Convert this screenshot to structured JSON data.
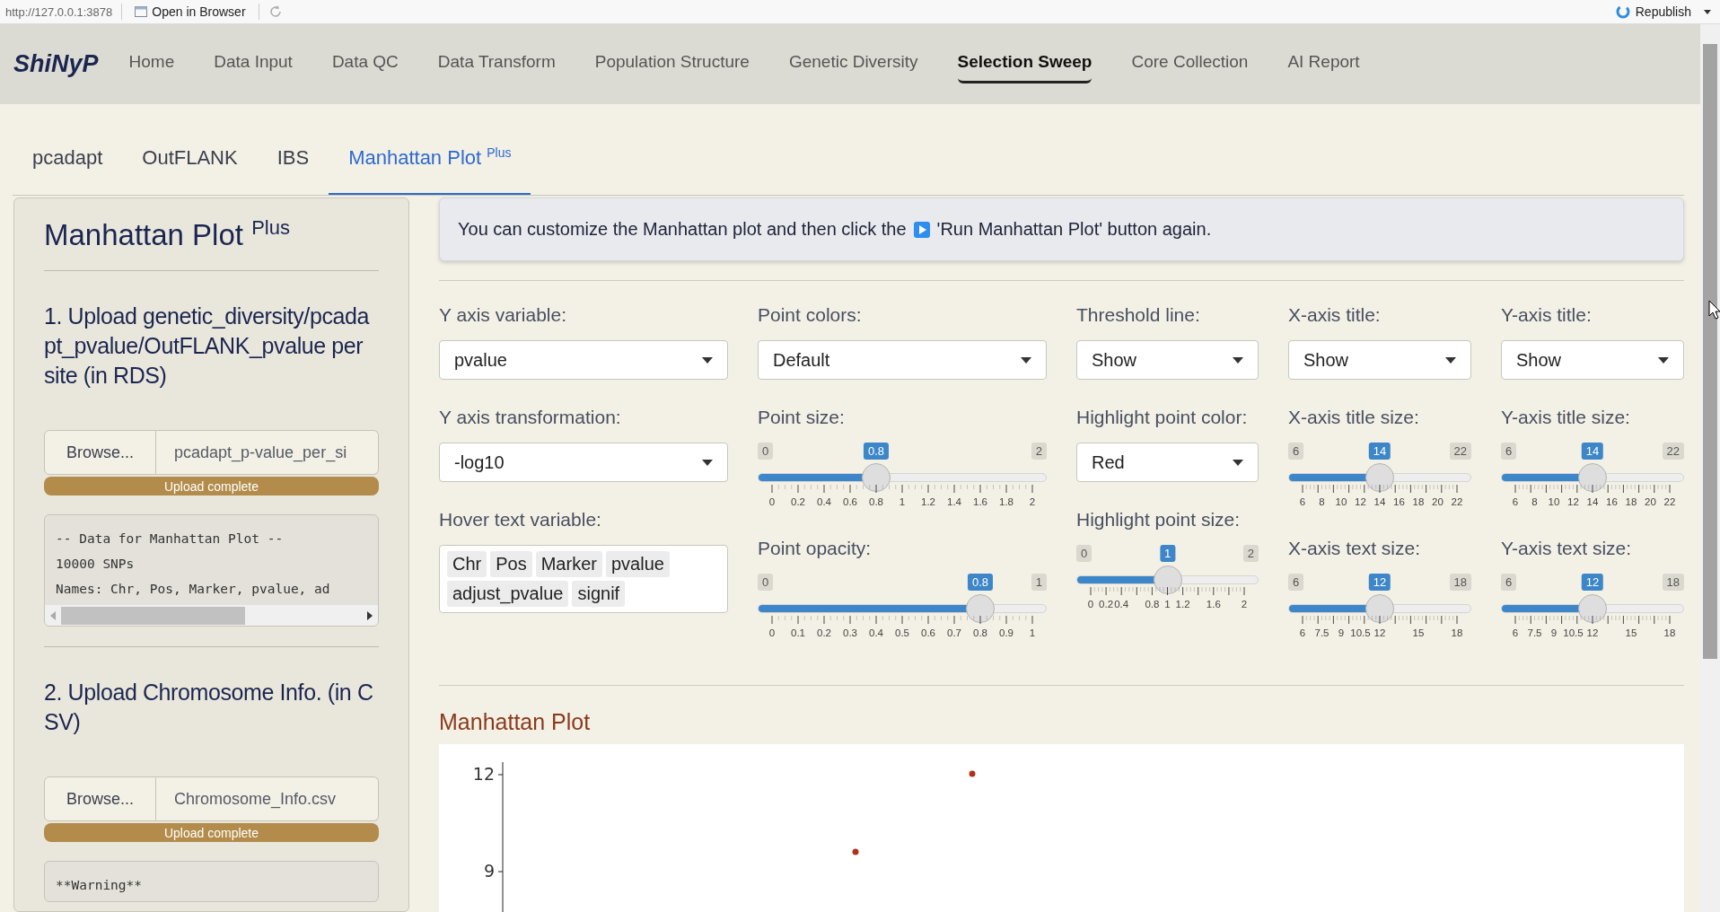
{
  "browser_bar": {
    "url": "http://127.0.0.1:3878",
    "open_button": "Open in Browser",
    "publish_button": "Republish"
  },
  "navbar": {
    "brand": "ShiNyP",
    "items": [
      {
        "label": "Home",
        "selected": false
      },
      {
        "label": "Data Input",
        "selected": false
      },
      {
        "label": "Data QC",
        "selected": false
      },
      {
        "label": "Data Transform",
        "selected": false
      },
      {
        "label": "Population Structure",
        "selected": false
      },
      {
        "label": "Genetic Diversity",
        "selected": false
      },
      {
        "label": "Selection Sweep",
        "selected": true
      },
      {
        "label": "Core Collection",
        "selected": false
      },
      {
        "label": "AI Report",
        "selected": false
      }
    ]
  },
  "tabs": [
    {
      "label": "pcadapt",
      "selected": false
    },
    {
      "label": "OutFLANK",
      "selected": false
    },
    {
      "label": "IBS",
      "selected": false
    },
    {
      "label": "Manhattan Plot $^{Plus}$",
      "selected": true
    }
  ],
  "sidebar": {
    "title": "Manhattan Plot $^{Plus}$",
    "steps": [
      {
        "heading": "1. Upload genetic_diversity/pcadapt_pvalue/OutFLANK_pvalue per site (in RDS)",
        "browse": "Browse...",
        "file": "pcadapt_p-value_per_si",
        "progress": {
          "label": "Upload complete",
          "level": 1
        },
        "output": [
          "-- Data for Manhattan Plot --",
          "10000 SNPs",
          "Names: Chr, Pos, Marker, pvalue, ad"
        ],
        "output_scrollbar": true
      },
      {
        "heading": "2. Upload Chromosome Info. (in CSV)",
        "browse": "Browse...",
        "file": "Chromosome_Info.csv",
        "progress": {
          "label": "Upload complete",
          "level": 1
        },
        "output": [
          "**Warning**"
        ],
        "output_scrollbar": false
      }
    ]
  },
  "info": {
    "text_before": "You can customize the Manhattan plot and then click the",
    "text_after": "'Run Manhattan Plot' button again."
  },
  "settings": {
    "columns": [
      {
        "controls": [
          {
            "kind": "select",
            "label": "Y axis variable:",
            "value": "pvalue"
          },
          {
            "kind": "select",
            "label": "Y axis transformation:",
            "value": "-log10"
          },
          {
            "kind": "multi",
            "label": "Hover text variable:",
            "tokens": [
              "Chr",
              "Pos",
              "Marker",
              "pvalue",
              "adjust_pvalue",
              "signif"
            ]
          }
        ]
      },
      {
        "controls": [
          {
            "kind": "select",
            "label": "Point colors:",
            "value": "Default"
          },
          {
            "kind": "slider",
            "label": "Point size:",
            "min": "0",
            "max": "2",
            "value": "0.8",
            "level": 0.4,
            "ticks": [
              "0",
              "0.2",
              "0.4",
              "0.6",
              "0.8",
              "1",
              "1.2",
              "1.4",
              "1.6",
              "1.8",
              "2"
            ]
          },
          {
            "kind": "slider",
            "label": "Point opacity:",
            "min": "0",
            "max": "1",
            "value": "0.8",
            "level": 0.8,
            "ticks": [
              "0",
              "0.1",
              "0.2",
              "0.3",
              "0.4",
              "0.5",
              "0.6",
              "0.7",
              "0.8",
              "0.9",
              "1"
            ]
          }
        ]
      },
      {
        "controls": [
          {
            "kind": "select",
            "label": "Threshold line:",
            "value": "Show"
          },
          {
            "kind": "select",
            "label": "Highlight point color:",
            "value": "Red"
          },
          {
            "kind": "slider",
            "label": "Highlight point size:",
            "min": "0",
            "max": "2",
            "value": "1",
            "level": 0.5,
            "ticks": [
              "0",
              "0.2",
              "0.4",
              "0.8",
              "1",
              "1.2",
              "1.6",
              "2"
            ]
          }
        ]
      },
      {
        "controls": [
          {
            "kind": "select",
            "label": "X-axis title:",
            "value": "Show"
          },
          {
            "kind": "slider",
            "label": "X-axis title size:",
            "min": "6",
            "max": "22",
            "value": "14",
            "level": 0.5,
            "ticks": [
              "6",
              "8",
              "10",
              "12",
              "14",
              "16",
              "18",
              "20",
              "22"
            ]
          },
          {
            "kind": "slider",
            "label": "X-axis text size:",
            "min": "6",
            "max": "18",
            "value": "12",
            "level": 0.5,
            "ticks": [
              "6",
              "7.5",
              "9",
              "10.5",
              "12",
              "15",
              "18"
            ]
          }
        ]
      },
      {
        "controls": [
          {
            "kind": "select",
            "label": "Y-axis title:",
            "value": "Show"
          },
          {
            "kind": "slider",
            "label": "Y-axis title size:",
            "min": "6",
            "max": "22",
            "value": "14",
            "level": 0.5,
            "ticks": [
              "6",
              "8",
              "10",
              "12",
              "14",
              "16",
              "18",
              "20",
              "22"
            ]
          },
          {
            "kind": "slider",
            "label": "Y-axis text size:",
            "min": "6",
            "max": "18",
            "value": "12",
            "level": 0.5,
            "ticks": [
              "6",
              "7.5",
              "9",
              "10.5",
              "12",
              "15",
              "18"
            ]
          }
        ]
      }
    ]
  },
  "plot": {
    "title": "Manhattan Plot",
    "y_axis_labels": [
      "12",
      "9"
    ]
  }
}
